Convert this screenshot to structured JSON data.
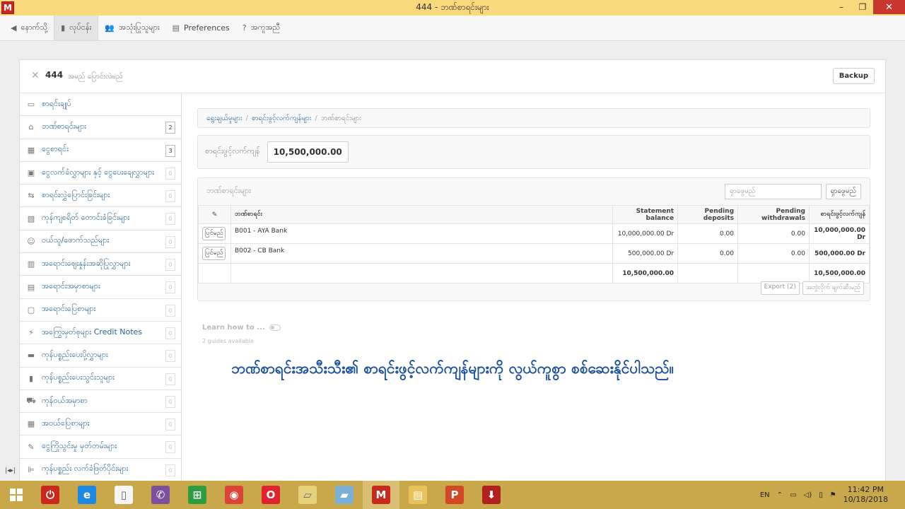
{
  "window": {
    "app_icon": "M",
    "title": "444 - ဘဏ်စာရင်းများ",
    "minimize": "–",
    "restore": "❐",
    "close": "✕"
  },
  "toolbar": {
    "items": [
      {
        "icon": "back-arrow-icon",
        "glyph": "◀",
        "label": "နောက်သို့"
      },
      {
        "icon": "building-icon",
        "glyph": "▮",
        "label": "လုပ်ငန်း",
        "active": true
      },
      {
        "icon": "users-icon",
        "glyph": "👥",
        "label": "အသုံးပြုသူများ"
      },
      {
        "icon": "preferences-icon",
        "glyph": "▤",
        "label": "Preferences"
      },
      {
        "icon": "help-icon",
        "glyph": "?",
        "label": "အကူအညီ"
      }
    ]
  },
  "company": {
    "close_glyph": "✕",
    "name": "444",
    "subtitle": "အမည် ပြောင်းလဲမည်",
    "backup_label": "Backup"
  },
  "sidebar": {
    "items": [
      {
        "icon": "monitor-icon",
        "glyph": "▭",
        "label": "စာရင်းချုပ်",
        "count": ""
      },
      {
        "icon": "bank-icon",
        "glyph": "⌂",
        "label": "ဘဏ်စာရင်းများ",
        "count": "2"
      },
      {
        "icon": "cash-icon",
        "glyph": "▦",
        "label": "ငွေစာရင်း",
        "count": "3"
      },
      {
        "icon": "receipts-icon",
        "glyph": "▣",
        "label": "ငွေလက်ခံလွှာများ နှင့် ငွေပေးချေလွှာများ",
        "count": "0"
      },
      {
        "icon": "transfer-icon",
        "glyph": "⇆",
        "label": "စာရင်းလွှဲပြောင်းခြင်းများ",
        "count": "0"
      },
      {
        "icon": "inventory-icon",
        "glyph": "▧",
        "label": "ကုန်ကျစရိတ် တောင်းခံခြင်းများ",
        "count": "0"
      },
      {
        "icon": "customers-icon",
        "glyph": "☺",
        "label": "ဝယ်သူ/ဖောက်သည်များ",
        "count": "0"
      },
      {
        "icon": "quotes-icon",
        "glyph": "▥",
        "label": "အရောင်းဈေးနှုန်းအဆိုပြုလွှာများ",
        "count": "0"
      },
      {
        "icon": "sales-order-icon",
        "glyph": "▤",
        "label": "အရောင်းအမှာစာများ",
        "count": "0"
      },
      {
        "icon": "invoice-icon",
        "glyph": "▢",
        "label": "အရောင်းပြေစာများ",
        "count": "0"
      },
      {
        "icon": "credit-note-icon",
        "glyph": "⚡",
        "label": "အကြွေးမှတ်စုများ Credit Notes",
        "count": "0"
      },
      {
        "icon": "delivery-icon",
        "glyph": "▬",
        "label": "ကုန်ပစ္စည်းပေးပို့လွှာများ",
        "count": "0"
      },
      {
        "icon": "suppliers-icon",
        "glyph": "▮",
        "label": "ကုန်ပစ္စည်းပေးသွင်းသူများ",
        "count": "0"
      },
      {
        "icon": "cart-icon",
        "glyph": "⛟",
        "label": "ကုန်ဝယ်အမှာစာ",
        "count": "0"
      },
      {
        "icon": "calendar-icon",
        "glyph": "▦",
        "label": "အဝယ်ပြေစာများ",
        "count": "0"
      },
      {
        "icon": "debit-note-icon",
        "glyph": "✎",
        "label": "ငွေကြိုသွင်းမှု မှတ်တမ်းများ",
        "count": "0"
      },
      {
        "icon": "goods-receipt-icon",
        "glyph": "⊫",
        "label": "ကုန်ပစ္စည်း လက်ခံဖြတ်ပိုင်းများ",
        "count": "0"
      }
    ]
  },
  "breadcrumb": {
    "items": [
      "ရွေးချယ်မှုများ",
      "စာရင်းဖွင့်လက်ကျန်များ"
    ],
    "current": "ဘဏ်စာရင်းများ",
    "separator": "/"
  },
  "opening_balance": {
    "label": "စာရင်းဖွင့်လက်ကျန်",
    "value": "10,500,000.00"
  },
  "accounts": {
    "title": "ဘဏ်စာရင်းများ",
    "search_placeholder": "ရှာဖွေမည်",
    "search_button": "ရှာဖွေမည်",
    "columns": [
      "ဘဏ်စာရင်း",
      "Statement balance",
      "Pending deposits",
      "Pending withdrawals",
      "စာရင်းဖွင့်လက်ကျန်"
    ],
    "rows": [
      {
        "edit": "ပြင်မည်",
        "name": "B001 - AYA Bank",
        "statement": "10,000,000.00 Dr",
        "deposits": "0.00",
        "withdrawals": "0.00",
        "opening": "10,000,000.00 Dr"
      },
      {
        "edit": "ပြင်မည်",
        "name": "B002 - CB Bank",
        "statement": "500,000.00 Dr",
        "deposits": "0.00",
        "withdrawals": "0.00",
        "opening": "500,000.00 Dr"
      }
    ],
    "totals": {
      "statement": "10,500,000.00",
      "opening": "10,500,000.00"
    },
    "export_label": "Export (2)",
    "edit_columns_label": "အတွဲလိုက် ချက်ဆီးမည်"
  },
  "guides": {
    "learn_label": "Learn how to ...",
    "available": "2 guides available"
  },
  "caption": "ဘဏ်စာရင်းအသီးသီး၏ စာရင်းဖွင့်လက်ကျန်များကို လွယ်ကူစွာ စစ်ဆေးနိုင်ပါသည်။",
  "dock_label": "|◂▸|",
  "taskbar": {
    "apps": [
      {
        "icon": "power-app-icon",
        "glyph": "⏻",
        "color": "#c8281e"
      },
      {
        "icon": "internet-explorer-icon",
        "glyph": "e",
        "color": "#1e88e5"
      },
      {
        "icon": "document-icon",
        "glyph": "▯",
        "color": "#f5f5f5"
      },
      {
        "icon": "viber-icon",
        "glyph": "✆",
        "color": "#7b519d"
      },
      {
        "icon": "store-icon",
        "glyph": "⊞",
        "color": "#2e9c41"
      },
      {
        "icon": "chrome-icon",
        "glyph": "◉",
        "color": "#db4437"
      },
      {
        "icon": "opera-icon",
        "glyph": "O",
        "color": "#e0232e"
      },
      {
        "icon": "files-icon",
        "glyph": "▱",
        "color": "#e6d27a"
      },
      {
        "icon": "notes-icon",
        "glyph": "▰",
        "color": "#7bb0d6"
      },
      {
        "icon": "manager-icon",
        "glyph": "M",
        "color": "#c8281e",
        "active": true
      },
      {
        "icon": "file-explorer-icon",
        "glyph": "▤",
        "color": "#e8c35a"
      },
      {
        "icon": "powerpoint-icon",
        "glyph": "P",
        "color": "#d24726"
      },
      {
        "icon": "downloader-icon",
        "glyph": "⬇",
        "color": "#b32020"
      }
    ],
    "language": "EN",
    "time": "11:42 PM",
    "date": "10/18/2018"
  },
  "colors": {
    "titlebar": "#f8d97c",
    "taskbar": "#c9a84b",
    "link": "#2a6496",
    "caption": "#1a4fa0",
    "close_button": "#c7372f"
  }
}
